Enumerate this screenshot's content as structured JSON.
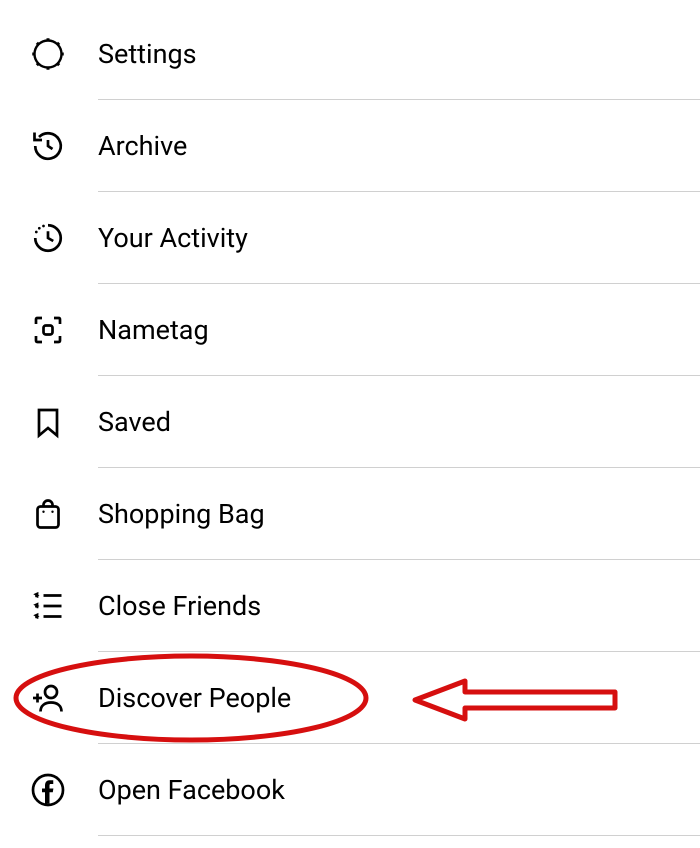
{
  "menu": {
    "items": [
      {
        "label": "Settings",
        "icon": "settings-icon"
      },
      {
        "label": "Archive",
        "icon": "archive-icon"
      },
      {
        "label": "Your Activity",
        "icon": "activity-icon"
      },
      {
        "label": "Nametag",
        "icon": "nametag-icon"
      },
      {
        "label": "Saved",
        "icon": "saved-icon"
      },
      {
        "label": "Shopping Bag",
        "icon": "shopping-bag-icon"
      },
      {
        "label": "Close Friends",
        "icon": "close-friends-icon"
      },
      {
        "label": "Discover People",
        "icon": "discover-people-icon"
      },
      {
        "label": "Open Facebook",
        "icon": "facebook-icon"
      }
    ]
  },
  "annotation": {
    "highlighted_item_index": 7,
    "color": "#d60f0f"
  }
}
